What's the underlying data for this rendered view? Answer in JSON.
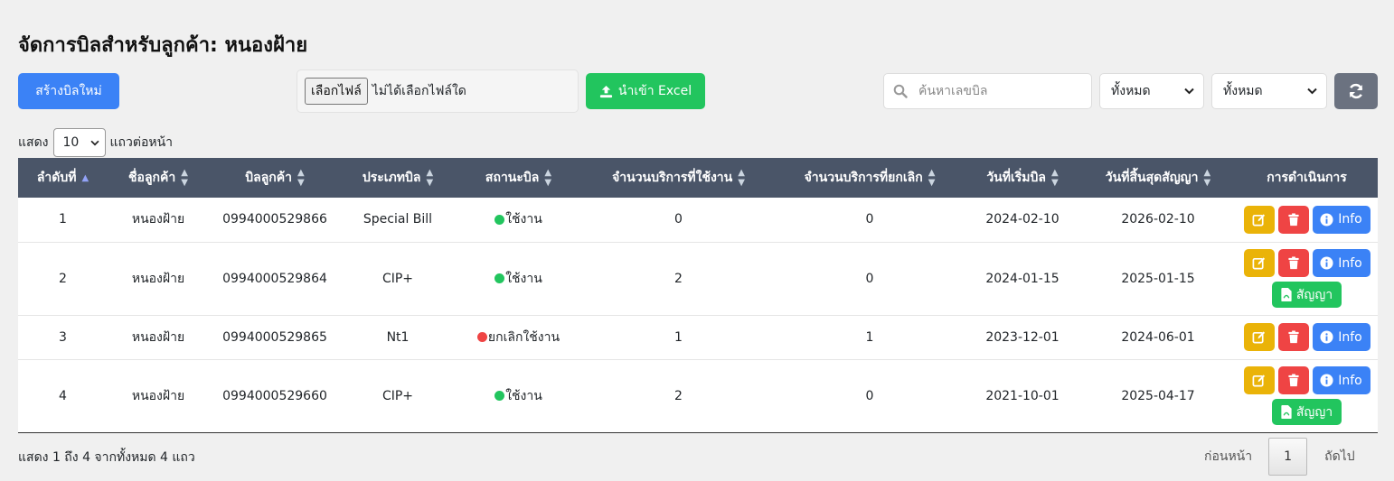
{
  "page": {
    "title": "จัดการบิลสำหรับลูกค้า: หนองฝ้าย"
  },
  "toolbar": {
    "create_label": "สร้างบิลใหม่",
    "file_choose_label": "เลือกไฟล์",
    "file_status": "ไม่ได้เลือกไฟล์ใด",
    "import_label": "นำเข้า Excel",
    "search_placeholder": "ค้นหาเลขบิล",
    "filter1": "ทั้งหมด",
    "filter2": "ทั้งหมด"
  },
  "length": {
    "prefix": "แสดง",
    "value": "10",
    "suffix": "แถวต่อหน้า"
  },
  "table": {
    "headers": [
      "ลำดับที่",
      "ชื่อลูกค้า",
      "บิลลูกค้า",
      "ประเภทบิล",
      "สถานะบิล",
      "จำนวนบริการที่ใช้งาน",
      "จำนวนบริการที่ยกเลิก",
      "วันที่เริ่มบิล",
      "วันที่สิ้นสุดสัญญา",
      "การดำเนินการ"
    ],
    "rows": [
      {
        "no": "1",
        "customer": "หนองฝ้าย",
        "bill": "0994000529866",
        "type": "Special Bill",
        "status": "ใช้งาน",
        "status_color": "#22c55e",
        "active": "0",
        "cancelled": "0",
        "start": "2024-02-10",
        "end": "2026-02-10",
        "has_contract": false
      },
      {
        "no": "2",
        "customer": "หนองฝ้าย",
        "bill": "0994000529864",
        "type": "CIP+",
        "status": "ใช้งาน",
        "status_color": "#22c55e",
        "active": "2",
        "cancelled": "0",
        "start": "2024-01-15",
        "end": "2025-01-15",
        "has_contract": true
      },
      {
        "no": "3",
        "customer": "หนองฝ้าย",
        "bill": "0994000529865",
        "type": "Nt1",
        "status": "ยกเลิกใช้งาน",
        "status_color": "#ef4444",
        "active": "1",
        "cancelled": "1",
        "start": "2023-12-01",
        "end": "2024-06-01",
        "has_contract": false
      },
      {
        "no": "4",
        "customer": "หนองฝ้าย",
        "bill": "0994000529660",
        "type": "CIP+",
        "status": "ใช้งาน",
        "status_color": "#22c55e",
        "active": "2",
        "cancelled": "0",
        "start": "2021-10-01",
        "end": "2025-04-17",
        "has_contract": true
      }
    ],
    "info_label": "Info",
    "contract_label": "สัญญา"
  },
  "footer": {
    "info": "แสดง 1 ถึง 4 จากทั้งหมด 4 แถว",
    "prev": "ก่อนหน้า",
    "page": "1",
    "next": "ถัดไป"
  }
}
